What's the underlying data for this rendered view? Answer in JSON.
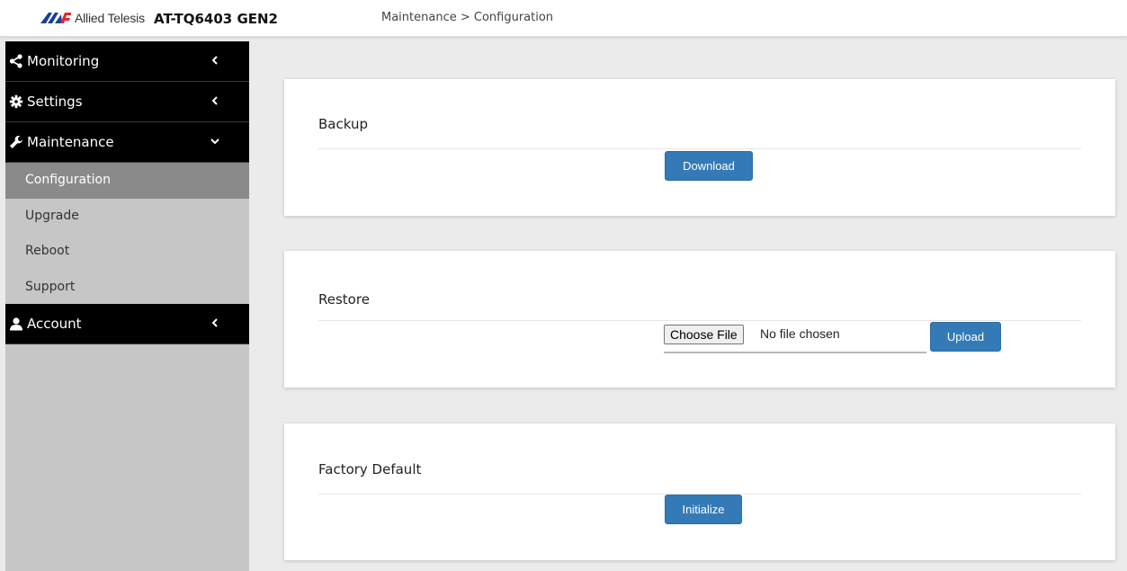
{
  "header": {
    "brand": "Allied Telesis",
    "product": "AT-TQ6403 GEN2",
    "breadcrumb": "Maintenance > Configuration",
    "brand_colors": {
      "blue": "#1b3f94",
      "red": "#e0282e"
    }
  },
  "sidebar": {
    "items": [
      {
        "label": "Monitoring",
        "icon": "share-icon",
        "chevron": "chevron-left-icon"
      },
      {
        "label": "Settings",
        "icon": "gear-icon",
        "chevron": "chevron-left-icon"
      },
      {
        "label": "Maintenance",
        "icon": "wrench-icon",
        "chevron": "chevron-down-icon",
        "children": [
          "Configuration",
          "Upgrade",
          "Reboot",
          "Support"
        ],
        "active_child": "Configuration"
      },
      {
        "label": "Account",
        "icon": "user-icon",
        "chevron": "chevron-left-icon"
      }
    ]
  },
  "main": {
    "backup": {
      "title": "Backup",
      "button": "Download"
    },
    "restore": {
      "title": "Restore",
      "choose_file": "Choose File",
      "file_status": "No file chosen",
      "button": "Upload"
    },
    "factory": {
      "title": "Factory Default",
      "button": "Initialize"
    }
  },
  "colors": {
    "primary_button": "#337ab7",
    "sidebar_dark": "#000000",
    "sidebar_light": "#c6c6c6",
    "sidebar_active": "#8a8a8a"
  }
}
